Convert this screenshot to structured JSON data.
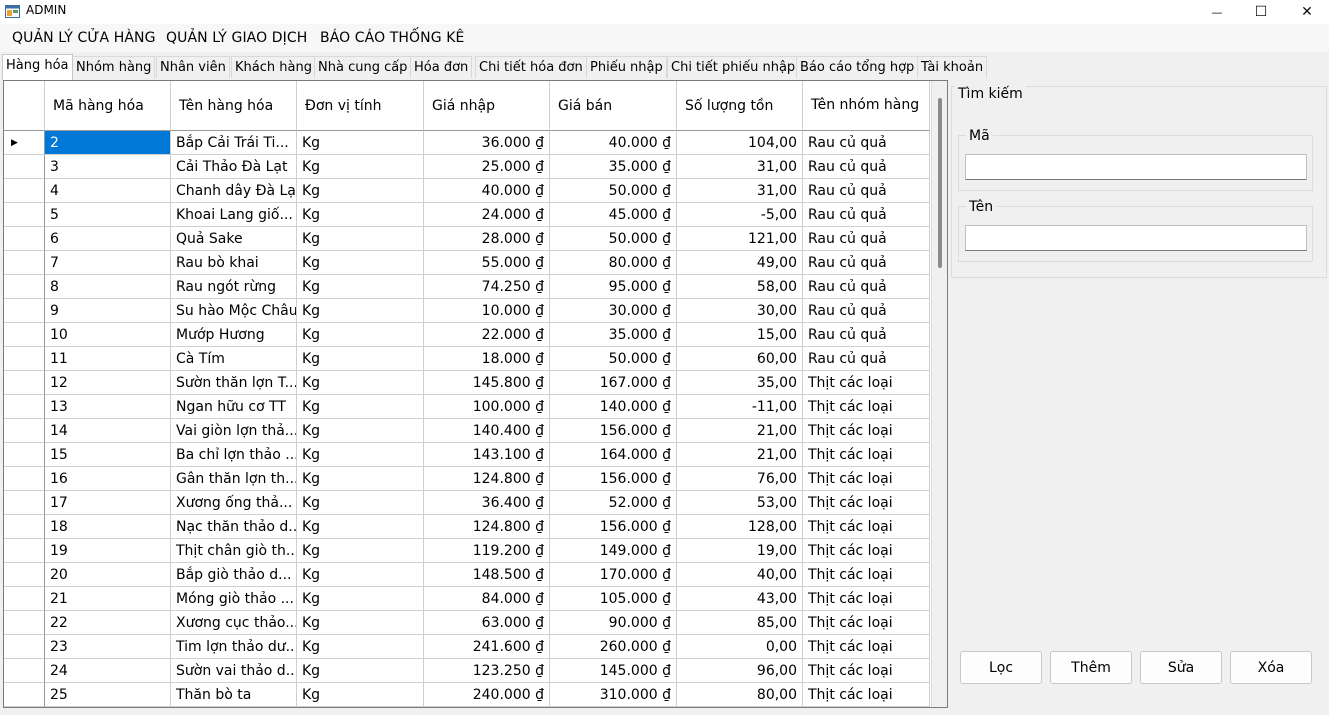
{
  "window": {
    "title": "ADMIN",
    "minimize_glyph": "—",
    "maximize_glyph": "☐",
    "close_glyph": "✕"
  },
  "menu": {
    "store": "QUẢN LÝ CỬA HÀNG",
    "transactions": "QUẢN LÝ GIAO DỊCH",
    "reports": "BÁO CÁO THỐNG KÊ"
  },
  "tabs": [
    {
      "label": "Hàng hóa",
      "active": true
    },
    {
      "label": "Nhóm hàng"
    },
    {
      "label": "Nhân viên"
    },
    {
      "label": "Khách hàng"
    },
    {
      "label": "Nhà cung cấp"
    },
    {
      "label": "Hóa đơn"
    },
    {
      "label": "Chi tiết hóa đơn"
    },
    {
      "label": "Phiếu nhập"
    },
    {
      "label": "Chi tiết phiếu nhập"
    },
    {
      "label": "Báo cáo tổng hợp"
    },
    {
      "label": "Tài khoản"
    }
  ],
  "grid": {
    "current_row_marker": "▶",
    "columns": [
      "Mã hàng hóa",
      "Tên hàng hóa",
      "Đơn vị tính",
      "Giá nhập",
      "Giá bán",
      "Số lượng tồn",
      "Tên nhóm hàng"
    ],
    "rows": [
      [
        "2",
        "Bắp Cải Trái Ti...",
        "Kg",
        "36.000 ₫",
        "40.000 ₫",
        "104,00",
        "Rau củ quả"
      ],
      [
        "3",
        "Cải Thảo Đà Lạt",
        "Kg",
        "25.000 ₫",
        "35.000 ₫",
        "31,00",
        "Rau củ quả"
      ],
      [
        "4",
        "Chanh dây Đà Lạt",
        "Kg",
        "40.000 ₫",
        "50.000 ₫",
        "31,00",
        "Rau củ quả"
      ],
      [
        "5",
        "Khoai Lang giố...",
        "Kg",
        "24.000 ₫",
        "45.000 ₫",
        "-5,00",
        "Rau củ quả"
      ],
      [
        "6",
        "Quả Sake",
        "Kg",
        "28.000 ₫",
        "50.000 ₫",
        "121,00",
        "Rau củ quả"
      ],
      [
        "7",
        "Rau bò khai",
        "Kg",
        "55.000 ₫",
        "80.000 ₫",
        "49,00",
        "Rau củ quả"
      ],
      [
        "8",
        "Rau ngót rừng",
        "Kg",
        "74.250 ₫",
        "95.000 ₫",
        "58,00",
        "Rau củ quả"
      ],
      [
        "9",
        "Su hào Mộc Châu",
        "Kg",
        "10.000 ₫",
        "30.000 ₫",
        "30,00",
        "Rau củ quả"
      ],
      [
        "10",
        "Mướp Hương",
        "Kg",
        "22.000 ₫",
        "35.000 ₫",
        "15,00",
        "Rau củ quả"
      ],
      [
        "11",
        "Cà Tím",
        "Kg",
        "18.000 ₫",
        "50.000 ₫",
        "60,00",
        "Rau củ quả"
      ],
      [
        "12",
        "Sườn thăn lợn T...",
        "Kg",
        "145.800 ₫",
        "167.000 ₫",
        "35,00",
        "Thịt các loại"
      ],
      [
        "13",
        "Ngan hữu cơ TT",
        "Kg",
        "100.000 ₫",
        "140.000 ₫",
        "-11,00",
        "Thịt các loại"
      ],
      [
        "14",
        "Vai giòn lợn thả...",
        "Kg",
        "140.400 ₫",
        "156.000 ₫",
        "21,00",
        "Thịt các loại"
      ],
      [
        "15",
        "Ba chỉ lợn thảo ...",
        "Kg",
        "143.100 ₫",
        "164.000 ₫",
        "21,00",
        "Thịt các loại"
      ],
      [
        "16",
        "Gân thăn lợn th...",
        "Kg",
        "124.800 ₫",
        "156.000 ₫",
        "76,00",
        "Thịt các loại"
      ],
      [
        "17",
        "Xương ống thả...",
        "Kg",
        "36.400 ₫",
        "52.000 ₫",
        "53,00",
        "Thịt các loại"
      ],
      [
        "18",
        "Nạc thăn thảo d...",
        "Kg",
        "124.800 ₫",
        "156.000 ₫",
        "128,00",
        "Thịt các loại"
      ],
      [
        "19",
        "Thịt chân giò th...",
        "Kg",
        "119.200 ₫",
        "149.000 ₫",
        "19,00",
        "Thịt các loại"
      ],
      [
        "20",
        "Bắp giò thảo d...",
        "Kg",
        "148.500 ₫",
        "170.000 ₫",
        "40,00",
        "Thịt các loại"
      ],
      [
        "21",
        "Móng giò thảo ...",
        "Kg",
        "84.000 ₫",
        "105.000 ₫",
        "43,00",
        "Thịt các loại"
      ],
      [
        "22",
        "Xương cục thảo...",
        "Kg",
        "63.000 ₫",
        "90.000 ₫",
        "85,00",
        "Thịt các loại"
      ],
      [
        "23",
        "Tim lợn thảo dư...",
        "Kg",
        "241.600 ₫",
        "260.000 ₫",
        "0,00",
        "Thịt các loại"
      ],
      [
        "24",
        "Sườn vai thảo d...",
        "Kg",
        "123.250 ₫",
        "145.000 ₫",
        "96,00",
        "Thịt các loại"
      ],
      [
        "25",
        "Thăn bò ta",
        "Kg",
        "240.000 ₫",
        "310.000 ₫",
        "80,00",
        "Thịt các loại"
      ]
    ]
  },
  "search": {
    "group_title": "Tìm kiếm",
    "code_label": "Mã",
    "code_value": "",
    "name_label": "Tên",
    "name_value": ""
  },
  "actions": {
    "filter": "Lọc",
    "add": "Thêm",
    "edit": "Sửa",
    "delete": "Xóa"
  }
}
